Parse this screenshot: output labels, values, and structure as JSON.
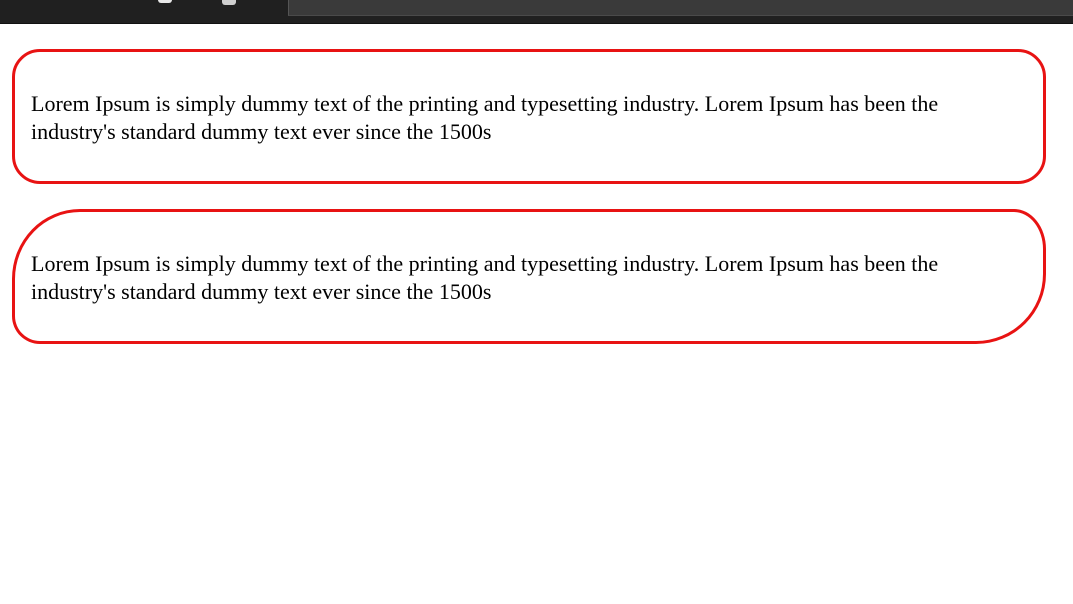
{
  "boxes": [
    {
      "text": "Lorem Ipsum is simply dummy text of the printing and typesetting industry. Lorem Ipsum has been the industry's standard dummy text ever since the 1500s"
    },
    {
      "text": "Lorem Ipsum is simply dummy text of the printing and typesetting industry. Lorem Ipsum has been the industry's standard dummy text ever since the 1500s"
    }
  ],
  "colors": {
    "border": "#e81313",
    "browser_bar": "#202020",
    "address_bar": "#3a3a3a",
    "text": "#000000"
  }
}
